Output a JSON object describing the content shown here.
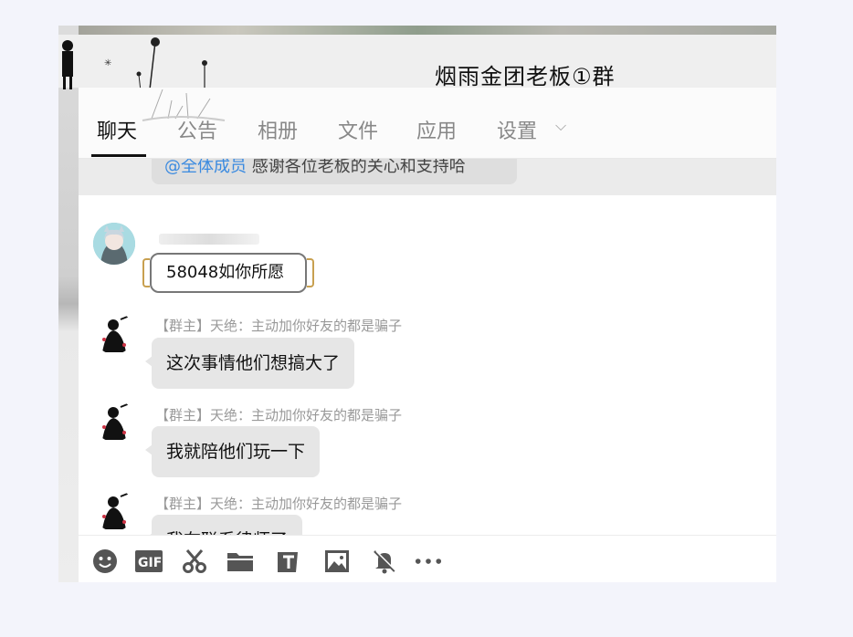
{
  "window": {
    "title": "烟雨金团老板①群"
  },
  "tabs": [
    {
      "label": "聊天",
      "active": true
    },
    {
      "label": "公告",
      "active": false
    },
    {
      "label": "相册",
      "active": false
    },
    {
      "label": "文件",
      "active": false
    },
    {
      "label": "应用",
      "active": false
    },
    {
      "label": "设置",
      "active": false
    }
  ],
  "previous_message": {
    "mention": "@全体成员",
    "text": "感谢各位老板的关心和支持哈"
  },
  "messages": [
    {
      "sender": "",
      "text": "58048如你所愿",
      "style": "special-frame"
    },
    {
      "sender": "【群主】天绝：主动加你好友的都是骗子",
      "text": "这次事情他们想搞大了"
    },
    {
      "sender": "【群主】天绝：主动加你好友的都是骗子",
      "text": "我就陪他们玩一下"
    },
    {
      "sender": "【群主】天绝：主动加你好友的都是骗子",
      "text": "我在联系律师了"
    }
  ],
  "toolbar": {
    "icons": [
      "emoji-icon",
      "gif-icon",
      "scissors-icon",
      "folder-icon",
      "font-icon",
      "image-icon",
      "mute-bell-icon",
      "more-icon"
    ]
  },
  "colors": {
    "mention": "#3a8ae0",
    "bubble": "#e6e6e6",
    "accent": "#111111"
  }
}
